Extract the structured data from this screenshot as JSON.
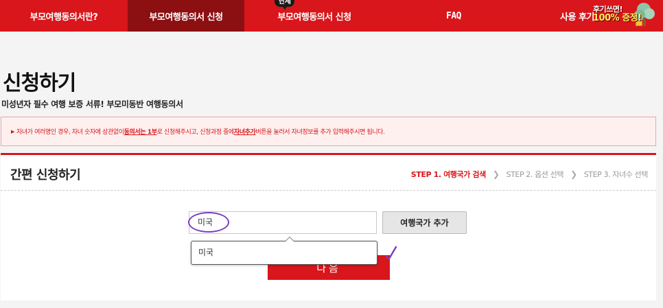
{
  "nav": {
    "items": [
      {
        "label": "부모여행동의서란?"
      },
      {
        "label": "부모여행동의서 신청"
      },
      {
        "label": "부모여행동의서 신청",
        "badge": "단체"
      },
      {
        "label": "FAQ"
      },
      {
        "label": "사용 후기"
      }
    ],
    "promo": {
      "line1": "후기쓰면!",
      "line2": "100% 증정!"
    }
  },
  "page": {
    "title": "신청하기",
    "subtitle": "미성년자 필수 여행 보증 서류! 부모미동반 여행동의서"
  },
  "notice": {
    "part1": "자녀가 여러명인 경우, 자녀 숫자에 상관없이 ",
    "emph1": "동의서는 1부",
    "part2": "로 신청해주시고, 신청과정 중에 ",
    "emph2": "자녀추가",
    "part3": " 버튼을 눌러서 자녀정보를 추가 입력해주시면 됩니다."
  },
  "form": {
    "title": "간편 신청하기",
    "steps": [
      "STEP 1. 여행국가 검색",
      "STEP 2. 옵션 선택",
      "STEP 3. 자녀수 선택"
    ],
    "country_input": "미국",
    "add_country_label": "여행국가 추가",
    "suggestion": "미국",
    "next_label": "다음"
  },
  "colors": {
    "brand": "#d8161b",
    "brand_dark": "#8c0f12",
    "annotation": "#7b3fc4"
  }
}
